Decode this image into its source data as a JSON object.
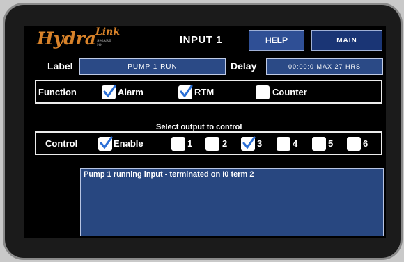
{
  "header": {
    "logo_main": "Hydra",
    "logo_link": "Link",
    "logo_sub": "SMART IO",
    "title": "INPUT 1",
    "help_label": "HELP",
    "main_label": "MAIN"
  },
  "label_row": {
    "label_caption": "Label",
    "label_value": "PUMP 1 RUN",
    "delay_caption": "Delay",
    "delay_value": "00:00:0 MAX 27 HRS"
  },
  "function": {
    "caption": "Function",
    "options": [
      {
        "label": "Alarm",
        "checked": true
      },
      {
        "label": "RTM",
        "checked": true
      },
      {
        "label": "Counter",
        "checked": false
      }
    ]
  },
  "control": {
    "hint": "Select output to control",
    "caption": "Control",
    "enable": {
      "label": "Enable",
      "checked": true
    },
    "outputs": [
      {
        "label": "1",
        "checked": false
      },
      {
        "label": "2",
        "checked": false
      },
      {
        "label": "3",
        "checked": true
      },
      {
        "label": "4",
        "checked": false
      },
      {
        "label": "5",
        "checked": false
      },
      {
        "label": "6",
        "checked": false
      }
    ]
  },
  "description": "Pump 1 running input - terminated on I0 term 2",
  "colors": {
    "accent": "#d9832a",
    "field_bg": "#2b4a86",
    "check": "#2b6fd6"
  }
}
